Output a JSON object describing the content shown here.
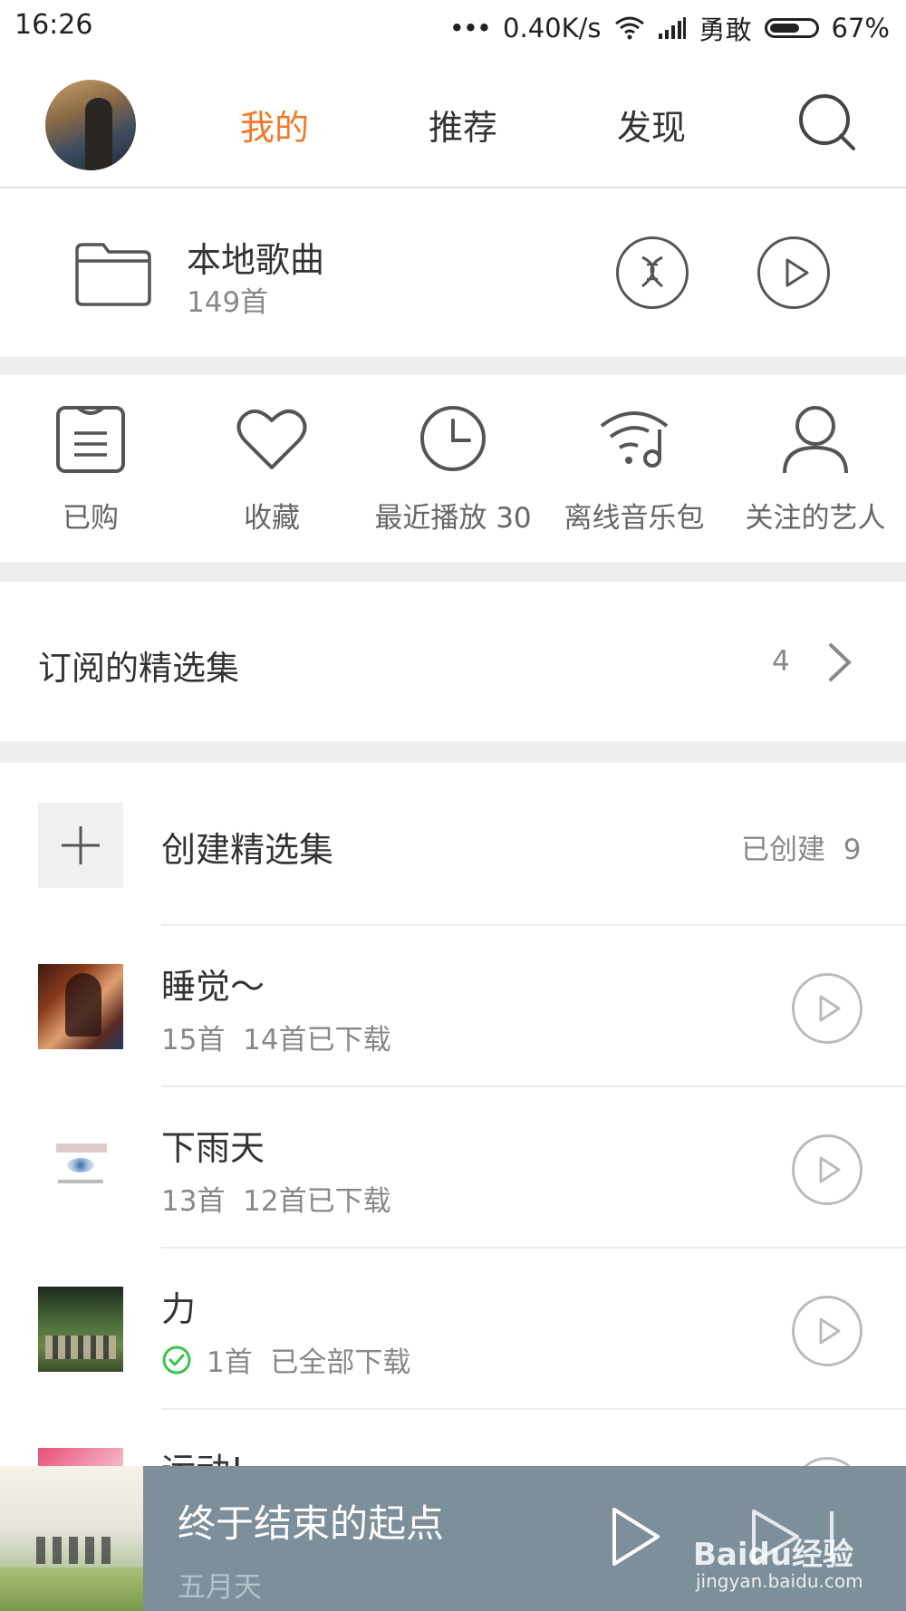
{
  "status_bar": {
    "time": "16:26",
    "dots": "•••",
    "speed": "0.40K/s",
    "carrier": "勇敢",
    "battery_level": 0.67,
    "battery": "67%"
  },
  "topnav": {
    "tabs": [
      {
        "label": "我的",
        "active": true
      },
      {
        "label": "推荐",
        "active": false
      },
      {
        "label": "发现",
        "active": false
      }
    ],
    "accent_color": "#f07a2a"
  },
  "local": {
    "title": "本地歌曲",
    "count": "149首"
  },
  "quick_actions": [
    {
      "label": "已购",
      "icon": "purchased-icon"
    },
    {
      "label": "收藏",
      "icon": "heart-icon"
    },
    {
      "label": "最近播放 30",
      "icon": "clock-icon"
    },
    {
      "label": "离线音乐包",
      "icon": "offline-wifi-icon"
    },
    {
      "label": "关注的艺人",
      "icon": "person-icon"
    }
  ],
  "subscribed": {
    "title": "订阅的精选集",
    "count": "4"
  },
  "create": {
    "title": "创建精选集",
    "created_label": "已创建  9"
  },
  "playlists": [
    {
      "name": "睡觉～",
      "meta": "15首  14首已下载",
      "downloaded_all": false
    },
    {
      "name": "下雨天",
      "meta": "13首  12首已下载",
      "downloaded_all": false
    },
    {
      "name": "力",
      "meta": "1首  已全部下载",
      "downloaded_all": true
    },
    {
      "name": "运动!",
      "meta": "",
      "downloaded_all": false
    }
  ],
  "player": {
    "song": "终于结束的起点",
    "artist": "五月天",
    "background": "#7c8f9b"
  },
  "watermark": {
    "line1": "Baidu经验",
    "line2": "jingyan.baidu.com"
  }
}
